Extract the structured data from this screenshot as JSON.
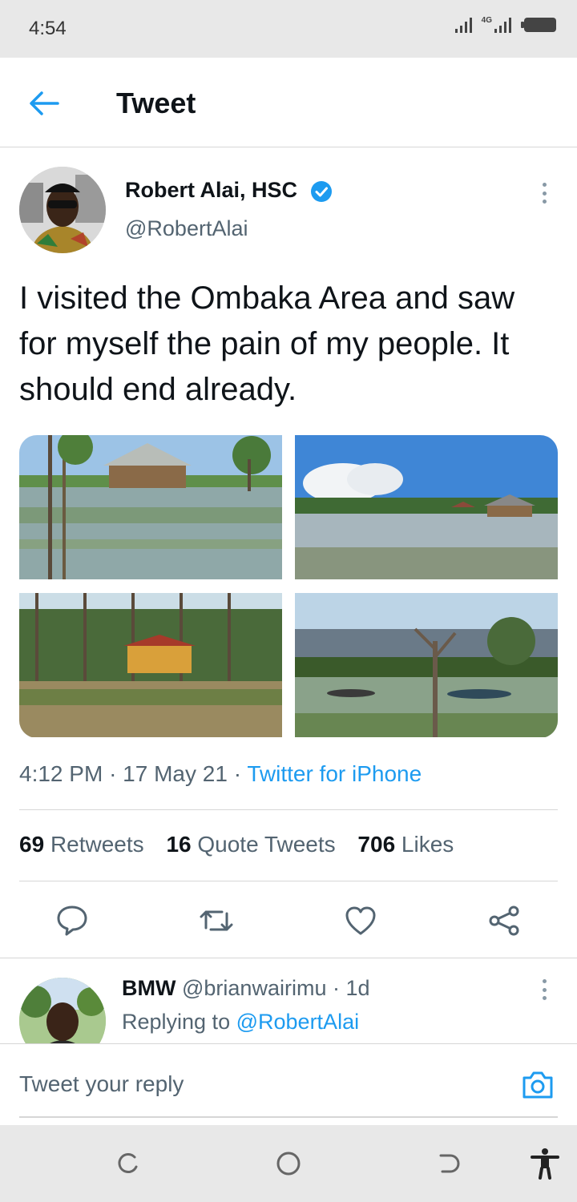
{
  "status_bar": {
    "time": "4:54",
    "network": "4G"
  },
  "header": {
    "title": "Tweet"
  },
  "tweet": {
    "author_name": "Robert Alai, HSC",
    "handle": "@RobertAlai",
    "text": "I visited the Ombaka Area and saw for myself the pain of my people. It should end already.",
    "time": "4:12 PM",
    "date": "17 May 21",
    "source": "Twitter for iPhone",
    "separator": "·",
    "stats": {
      "retweets_count": "69",
      "retweets_label": "Retweets",
      "quotes_count": "16",
      "quotes_label": "Quote Tweets",
      "likes_count": "706",
      "likes_label": "Likes"
    }
  },
  "reply": {
    "name": "BMW",
    "handle": "@brianwairimu",
    "age": "1d",
    "replying_prefix": "Replying to",
    "replying_to": "@RobertAlai"
  },
  "composer": {
    "placeholder": "Tweet your reply"
  },
  "icons": {
    "back": "arrow-left-icon",
    "verified": "verified-badge-icon",
    "more": "more-vertical-icon",
    "reply": "comment-icon",
    "retweet": "retweet-icon",
    "like": "heart-icon",
    "share": "share-icon",
    "camera": "camera-icon"
  },
  "colors": {
    "accent": "#1d9bf0",
    "text": "#0f1419",
    "secondary": "#536471",
    "divider": "#d6d6d6"
  }
}
